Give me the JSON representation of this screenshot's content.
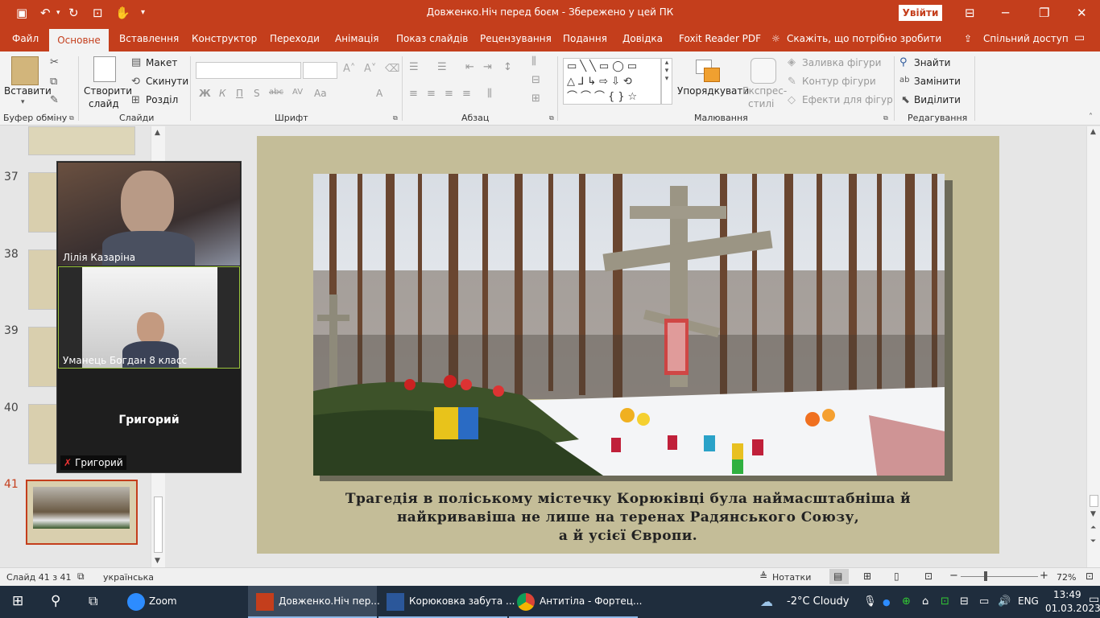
{
  "app": {
    "title": "Довженко.Ніч перед боєм  -  Збережено у цей ПК",
    "login_label": "Увійти"
  },
  "tabs": [
    "Файл",
    "Основне",
    "Вставлення",
    "Конструктор",
    "Переходи",
    "Анімація",
    "Показ слайдів",
    "Рецензування",
    "Подання",
    "Довідка",
    "Foxit Reader PDF"
  ],
  "tell_me": "Скажіть, що потрібно зробити",
  "share": "Спільний доступ",
  "ribbon": {
    "clipboard": {
      "paste": "Вставити",
      "group": "Буфер обміну"
    },
    "slides": {
      "new_slide_1": "Створити",
      "new_slide_2": "слайд",
      "layout": "Макет",
      "reset": "Скинути",
      "section": "Розділ",
      "group": "Слайди"
    },
    "font": {
      "group": "Шрифт",
      "bold": "Ж",
      "italic": "К",
      "underline": "П",
      "shadow": "S",
      "strike": "abc",
      "spacing": "AV",
      "case": "Aa",
      "color": "A"
    },
    "paragraph": {
      "group": "Абзац"
    },
    "drawing": {
      "arrange": "Упорядкувати",
      "quick_styles_1": "Експрес-",
      "quick_styles_2": "стилі",
      "fill": "Заливка фігури",
      "outline": "Контур фігури",
      "effects": "Ефекти для фігур",
      "group": "Малювання"
    },
    "editing": {
      "find": "Знайти",
      "replace": "Замінити",
      "select": "Виділити",
      "group": "Редагування"
    }
  },
  "thumbnails": [
    {
      "num": "37"
    },
    {
      "num": "38"
    },
    {
      "num": "39"
    },
    {
      "num": "40"
    },
    {
      "num": "41",
      "active": true
    }
  ],
  "video": {
    "participants": [
      {
        "name": "Лілія Казаріна"
      },
      {
        "name": "Уманець Богдан 8 класс"
      }
    ],
    "tile_name": "Григорий",
    "muted_name": "Григорий"
  },
  "slide": {
    "caption_1": "Трагедія в поліському містечку Корюківці була наймасштабніша й",
    "caption_2": "найкривавіша не лише на теренах Радянського Союзу,",
    "caption_3": "а й усієї Європи."
  },
  "status": {
    "slide_counter": "Слайд 41 з 41",
    "language": "українська",
    "notes": "Нотатки",
    "zoom": "72%"
  },
  "taskbar": {
    "apps": [
      {
        "label": "Zoom"
      },
      {
        "label": "Довженко.Ніч пер..."
      },
      {
        "label": "Корюковка забута ..."
      },
      {
        "label": "Антитіла - Фортец..."
      }
    ],
    "weather": "-2°C  Cloudy",
    "lang": "ENG",
    "time": "13:49",
    "date": "01.03.2023"
  },
  "colors": {
    "accent": "#c43e1c",
    "taskbar": "#1f2d3d",
    "slide_bg": "#c4bd98"
  }
}
